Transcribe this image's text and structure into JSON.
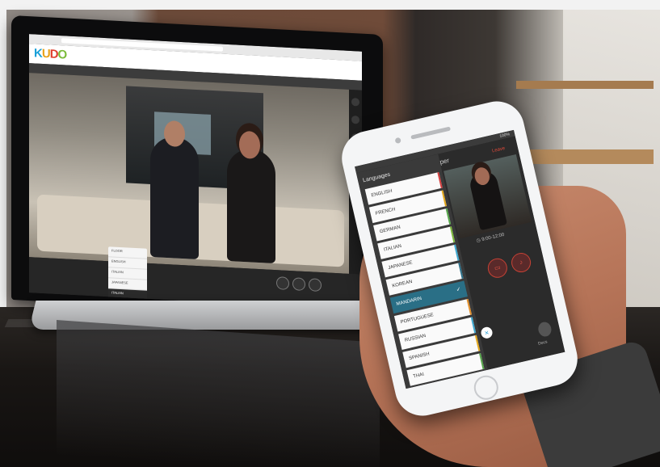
{
  "laptop": {
    "logo": {
      "k": "K",
      "u": "U",
      "d": "D",
      "o": "O"
    },
    "video_language_menu": [
      "FLOOR",
      "ENGLISH",
      "ITALIAN",
      "JAPANESE",
      "ITALIAN"
    ]
  },
  "phone": {
    "status_right": "100%",
    "languages_heading": "Languages",
    "interpreter_title_partial": "per",
    "leave_label": "Leave",
    "time_range": "9:00-12:00",
    "docs_label": "Docs",
    "languages": [
      {
        "label": "ENGLISH",
        "color": "#d33d3d",
        "selected": false
      },
      {
        "label": "FRENCH",
        "color": "#e3a71b",
        "selected": false
      },
      {
        "label": "GERMAN",
        "color": "#56a64a",
        "selected": false
      },
      {
        "label": "ITALIAN",
        "color": "#7bb83a",
        "selected": false
      },
      {
        "label": "JAPANESE",
        "color": "#3da7cf",
        "selected": false
      },
      {
        "label": "KOREAN",
        "color": "#2c6f88",
        "selected": false
      },
      {
        "label": "MANDARIN",
        "color": "#2a6f86",
        "selected": true
      },
      {
        "label": "PORTUGUESE",
        "color": "#e28f2b",
        "selected": false
      },
      {
        "label": "RUSSIAN",
        "color": "#3da7cf",
        "selected": false
      },
      {
        "label": "SPANISH",
        "color": "#e3a71b",
        "selected": false
      },
      {
        "label": "THAI",
        "color": "#56a64a",
        "selected": false
      }
    ],
    "check_symbol": "✓",
    "close_symbol": "×"
  }
}
